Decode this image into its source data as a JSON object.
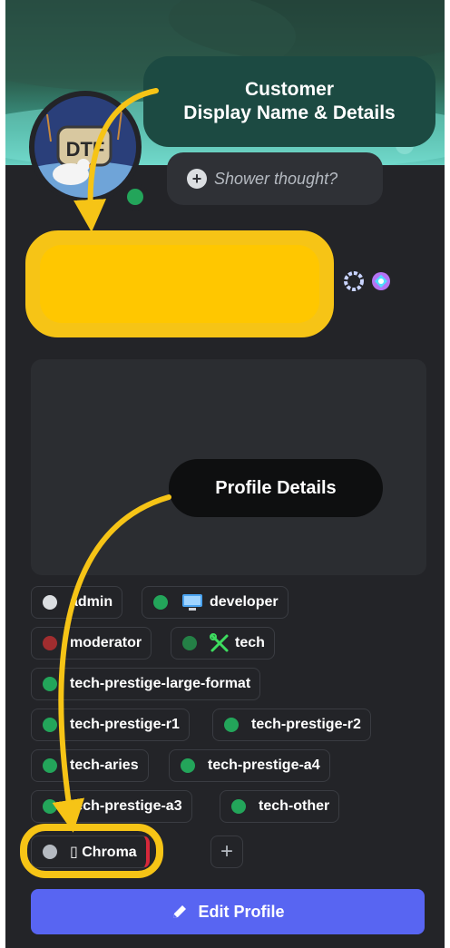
{
  "annotations": {
    "customer_line1": "Customer",
    "customer_line2": "Display Name & Details",
    "profile_details": "Profile Details"
  },
  "avatar": {
    "text": "DTF"
  },
  "status": {
    "placeholder": "Shower thought?"
  },
  "roles": [
    {
      "label": "admin",
      "color": "#dbdee1"
    },
    {
      "label": "developer",
      "color": "#23a55a",
      "icon": "computer-icon"
    },
    {
      "label": "moderator",
      "color": "#a12d2f"
    },
    {
      "label": "tech",
      "color": "#248046",
      "icon": "tools-icon"
    },
    {
      "label": "tech-prestige-large-format",
      "color": "#23a55a"
    },
    {
      "label": "tech-prestige-r1",
      "color": "#23a55a"
    },
    {
      "label": "tech-prestige-r2",
      "color": "#23a55a"
    },
    {
      "label": "tech-aries",
      "color": "#23a55a"
    },
    {
      "label": "tech-prestige-a4",
      "color": "#23a55a"
    },
    {
      "label": "tech-prestige-a3",
      "color": "#23a55a"
    },
    {
      "label": "tech-other",
      "color": "#23a55a"
    },
    {
      "label": "▯ Chroma",
      "color": "#b5bac1"
    }
  ],
  "add_role": "+",
  "edit_button": {
    "label": "Edit Profile"
  },
  "colors": {
    "highlight": "#f6c416",
    "online": "#23a55a",
    "primary_button": "#5865f2",
    "card_bg": "#232428"
  }
}
